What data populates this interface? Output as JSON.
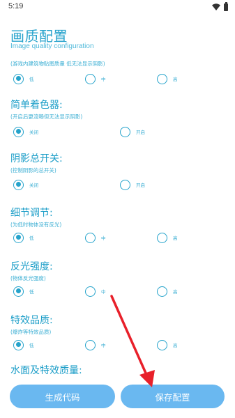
{
  "status_bar": {
    "time": "5:19",
    "icons": [
      "wifi-icon",
      "battery-icon"
    ]
  },
  "header": {
    "title": "画质配置",
    "subtitle": "Image quality configuration"
  },
  "sections": [
    {
      "title": "",
      "desc": "(游戏内建筑物贴图质量 低无法显示阴影)",
      "options": [
        {
          "label": "低",
          "checked": true
        },
        {
          "label": "中",
          "checked": false
        },
        {
          "label": "高",
          "checked": false
        }
      ]
    },
    {
      "title": "简单着色器:",
      "desc": "(开启后更流畅但无法显示阴影)",
      "options": [
        {
          "label": "关闭",
          "checked": true
        },
        {
          "label": "开启",
          "checked": false
        }
      ]
    },
    {
      "title": "阴影总开关:",
      "desc": "(控制阴影的总开关)",
      "options": [
        {
          "label": "关闭",
          "checked": true
        },
        {
          "label": "开启",
          "checked": false
        }
      ]
    },
    {
      "title": "细节调节:",
      "desc": "(为低时物体没有反光)",
      "options": [
        {
          "label": "低",
          "checked": true
        },
        {
          "label": "中",
          "checked": false
        },
        {
          "label": "高",
          "checked": false
        }
      ]
    },
    {
      "title": "反光强度:",
      "desc": "(物体反光强度)",
      "options": [
        {
          "label": "低",
          "checked": true
        },
        {
          "label": "中",
          "checked": false
        },
        {
          "label": "高",
          "checked": false
        }
      ]
    },
    {
      "title": "特效品质:",
      "desc": "(爆炸等特效品质)",
      "options": [
        {
          "label": "低",
          "checked": true
        },
        {
          "label": "中",
          "checked": false
        },
        {
          "label": "高",
          "checked": false
        }
      ]
    },
    {
      "title": "水面及特效质量:",
      "desc": "",
      "options": []
    }
  ],
  "buttons": {
    "generate": "生成代码",
    "save": "保存配置"
  },
  "colors": {
    "accent": "#25a3cb",
    "button": "#6ab8f0",
    "annotation_arrow": "#e8202a"
  }
}
